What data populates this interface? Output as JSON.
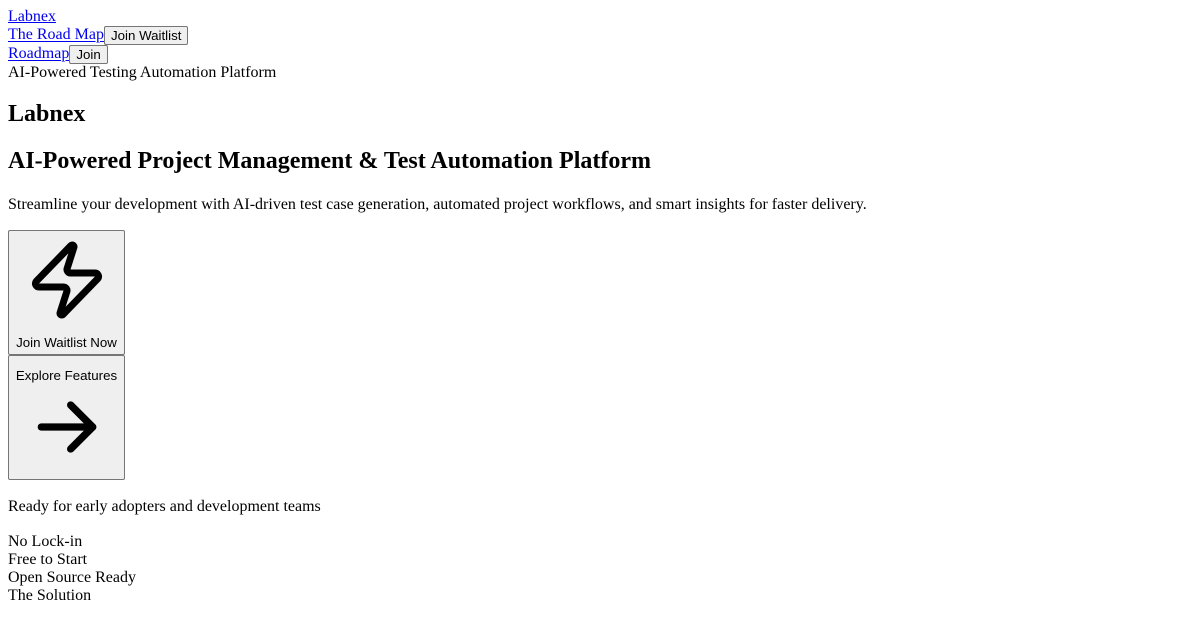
{
  "nav": {
    "brand": "Labnex",
    "roadmap_link": "The Road Map",
    "join_waitlist_button": "Join Waitlist",
    "roadmap_short_link": "Roadmap",
    "join_button": "Join"
  },
  "hero": {
    "tagline": "AI-Powered Testing Automation Platform",
    "brand_heading": "Labnex",
    "headline": "AI-Powered Project Management & Test Automation Platform",
    "subtitle": "Streamline your development with AI-driven test case generation, automated project workflows, and smart insights for faster delivery.",
    "primary_cta": {
      "label": "Join Waitlist Now",
      "icon": "lightning-bolt-icon"
    },
    "secondary_cta": {
      "label": "Explore Features",
      "icon": "arrow-right-icon"
    },
    "ready_text": "Ready for early adopters and development teams"
  },
  "features": [
    "No Lock-in",
    "Free to Start",
    "Open Source Ready",
    "The Solution"
  ]
}
